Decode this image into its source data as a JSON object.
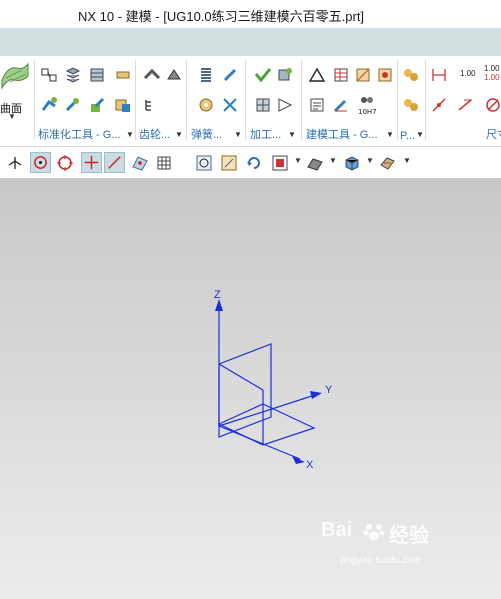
{
  "window": {
    "title": "NX 10 - 建模 - [UG10.0练习三维建模六百零五.prt]"
  },
  "ribbon": {
    "surface_label": "曲面",
    "groups": [
      {
        "label": "标准化工具 - G..."
      },
      {
        "label": "齿轮..."
      },
      {
        "label": "弹簧..."
      },
      {
        "label": "加工..."
      },
      {
        "label": "建模工具 - G..."
      },
      {
        "label": "尺寸"
      }
    ],
    "dim_value_1": "1.00",
    "dim_value_2": "1.00",
    "dim_value_3": "1.00",
    "pmi_code": "10H7"
  },
  "viewport": {
    "axis_labels": {
      "x": "X",
      "y": "Y",
      "z": "Z"
    },
    "triad_color": "#1a2fd8"
  },
  "watermark": {
    "brand_a": "Bai",
    "brand_b": "经验",
    "url": "jingyan.baidu.com"
  },
  "colors": {
    "tabstrip": "#cfe0e0",
    "group_label": "#2a6fb0"
  }
}
